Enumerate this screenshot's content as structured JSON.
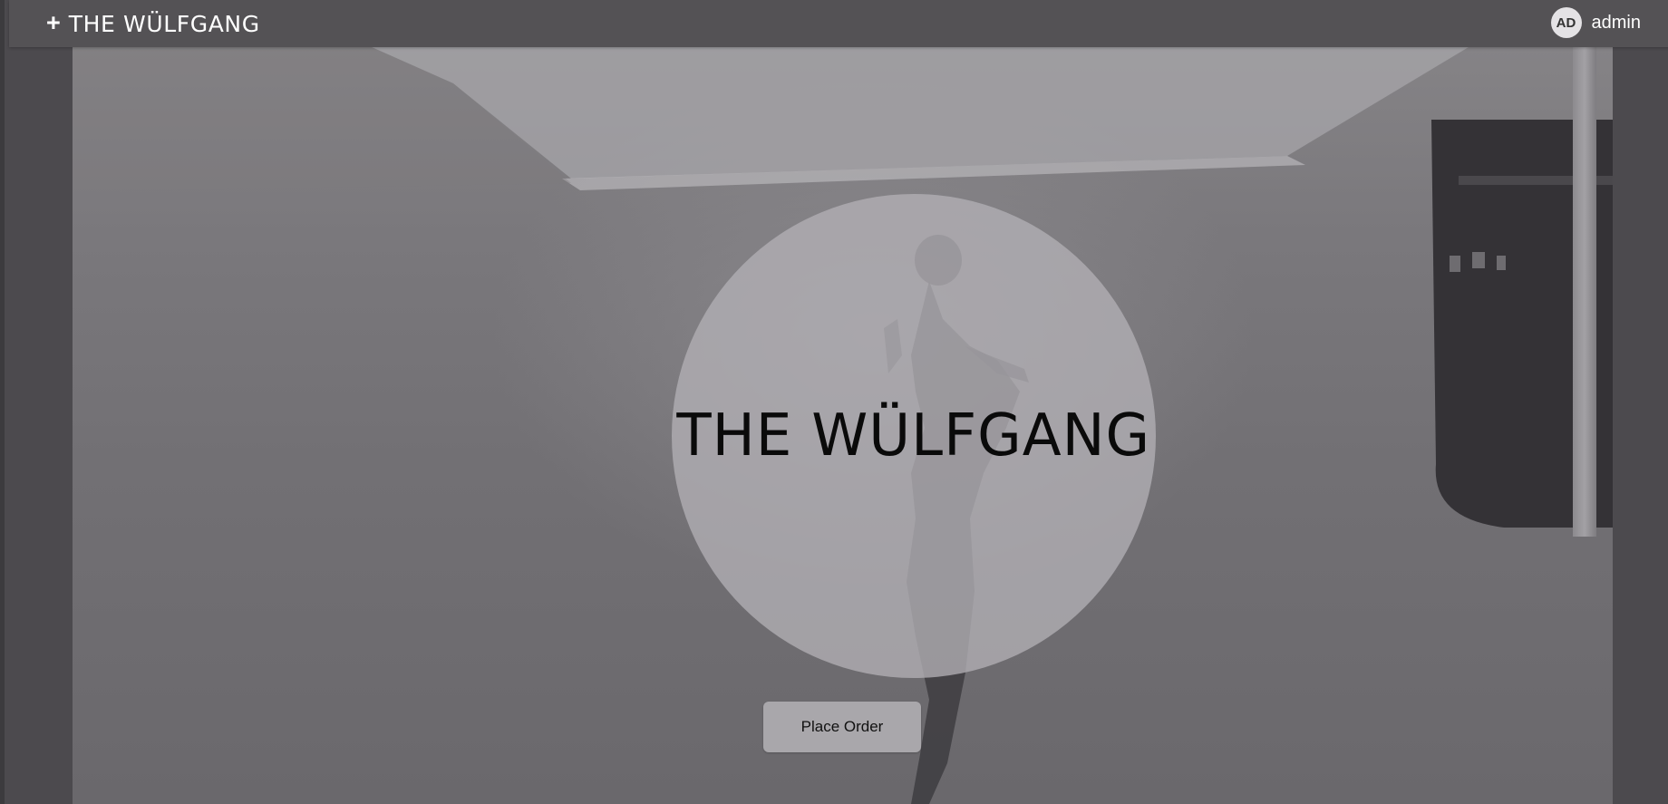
{
  "header": {
    "brand_plus": "+",
    "brand_name": "THE WÜLFGANG",
    "user": {
      "initials": "AD",
      "name": "admin"
    }
  },
  "hero": {
    "title": "THE WÜLFGANG",
    "cta_label": "Place Order"
  },
  "colors": {
    "topbar": "#545255",
    "circle": "#b2b0b5",
    "button": "#a9a7ab"
  }
}
